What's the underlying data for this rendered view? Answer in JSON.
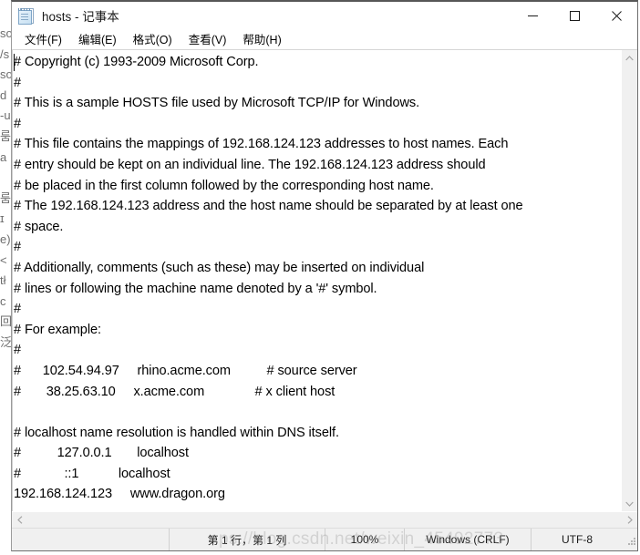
{
  "window": {
    "title": "hosts - 记事本",
    "icon": "notepad-icon",
    "controls": {
      "minimize": "最小化",
      "maximize": "最大化",
      "close": "关闭"
    }
  },
  "menu": {
    "items": [
      {
        "label": "文件(F)",
        "name": "menu-file"
      },
      {
        "label": "编辑(E)",
        "name": "menu-edit"
      },
      {
        "label": "格式(O)",
        "name": "menu-format"
      },
      {
        "label": "查看(V)",
        "name": "menu-view"
      },
      {
        "label": "帮助(H)",
        "name": "menu-help"
      }
    ]
  },
  "editor": {
    "content": "# Copyright (c) 1993-2009 Microsoft Corp.\n#\n# This is a sample HOSTS file used by Microsoft TCP/IP for Windows.\n#\n# This file contains the mappings of 192.168.124.123 addresses to host names. Each\n# entry should be kept on an individual line. The 192.168.124.123 address should\n# be placed in the first column followed by the corresponding host name.\n# The 192.168.124.123 address and the host name should be separated by at least one\n# space.\n#\n# Additionally, comments (such as these) may be inserted on individual\n# lines or following the machine name denoted by a '#' symbol.\n#\n# For example:\n#\n#      102.54.94.97     rhino.acme.com          # source server\n#       38.25.63.10     x.acme.com              # x client host\n\n# localhost name resolution is handled within DNS itself.\n#          127.0.0.1       localhost\n#            ::1           localhost\n192.168.124.123     www.dragon.org",
    "lines": [
      "# Copyright (c) 1993-2009 Microsoft Corp.",
      "#",
      "# This is a sample HOSTS file used by Microsoft TCP/IP for Windows.",
      "#",
      "# This file contains the mappings of 192.168.124.123 addresses to host names. Each",
      "# entry should be kept on an individual line. The 192.168.124.123 address should",
      "# be placed in the first column followed by the corresponding host name.",
      "# The 192.168.124.123 address and the host name should be separated by at least one",
      "# space.",
      "#",
      "# Additionally, comments (such as these) may be inserted on individual",
      "# lines or following the machine name denoted by a '#' symbol.",
      "#",
      "# For example:",
      "#",
      "#      102.54.94.97     rhino.acme.com          # source server",
      "#       38.25.63.10     x.acme.com              # x client host",
      "",
      "# localhost name resolution is handled within DNS itself.",
      "#          127.0.0.1       localhost",
      "#            ::1           localhost",
      "192.168.124.123     www.dragon.org"
    ]
  },
  "scrollbars": {
    "vertical": {
      "up": "▲",
      "down": "▼"
    },
    "horizontal": {
      "left": "◀",
      "right": "▶"
    }
  },
  "status_bar": {
    "position": "第 1 行，第 1 列",
    "zoom": "100%",
    "line_ending": "Windows (CRLF)",
    "encoding": "UTF-8"
  },
  "watermark": {
    "text": "ps://blog.csdn.net/weixin_45492773"
  },
  "background": {
    "left_strip": [
      "so",
      "/s",
      "so",
      "d",
      "-u",
      "룸",
      "a",
      "",
      "룸",
      "ɪ",
      "e)",
      "<",
      "tł",
      "c",
      "回",
      "泛"
    ]
  },
  "colors": {
    "window_bg": "#ffffff",
    "titlebar_border": "#575757",
    "text": "#000000",
    "status_bg": "#f0f0f0",
    "scrollbar_bg": "#f0f0f0",
    "close_hover": "#e81123"
  }
}
